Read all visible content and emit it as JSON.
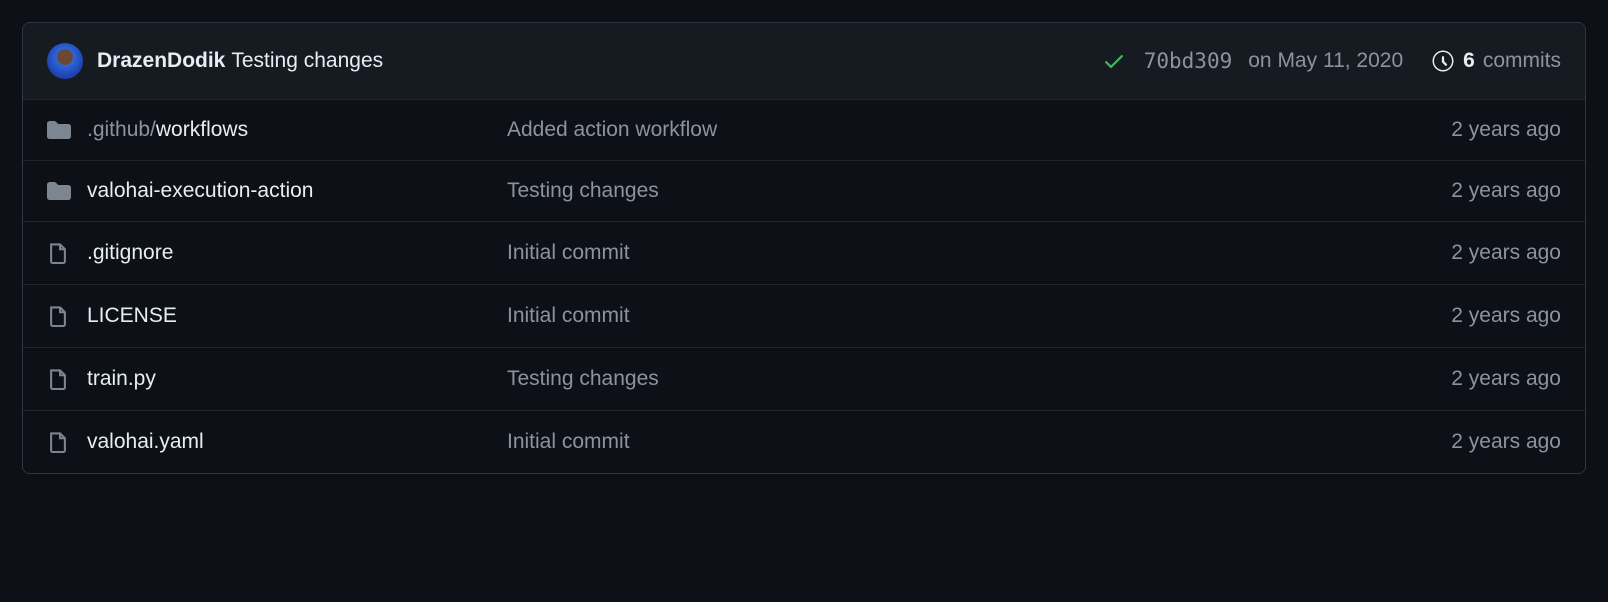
{
  "header": {
    "author": "DrazenDodik",
    "commit_message": "Testing changes",
    "status_icon": "check",
    "sha": "70bd309",
    "date": "on May 11, 2020",
    "commits_count": "6",
    "commits_label": "commits"
  },
  "files": [
    {
      "type": "dir",
      "name_pre": ".github/",
      "name_main": "workflows",
      "message": "Added action workflow",
      "age": "2 years ago"
    },
    {
      "type": "dir",
      "name_pre": "",
      "name_main": "valohai-execution-action",
      "message": "Testing changes",
      "age": "2 years ago"
    },
    {
      "type": "file",
      "name_pre": "",
      "name_main": ".gitignore",
      "message": "Initial commit",
      "age": "2 years ago"
    },
    {
      "type": "file",
      "name_pre": "",
      "name_main": "LICENSE",
      "message": "Initial commit",
      "age": "2 years ago"
    },
    {
      "type": "file",
      "name_pre": "",
      "name_main": "train.py",
      "message": "Testing changes",
      "age": "2 years ago"
    },
    {
      "type": "file",
      "name_pre": "",
      "name_main": "valohai.yaml",
      "message": "Initial commit",
      "age": "2 years ago"
    }
  ]
}
